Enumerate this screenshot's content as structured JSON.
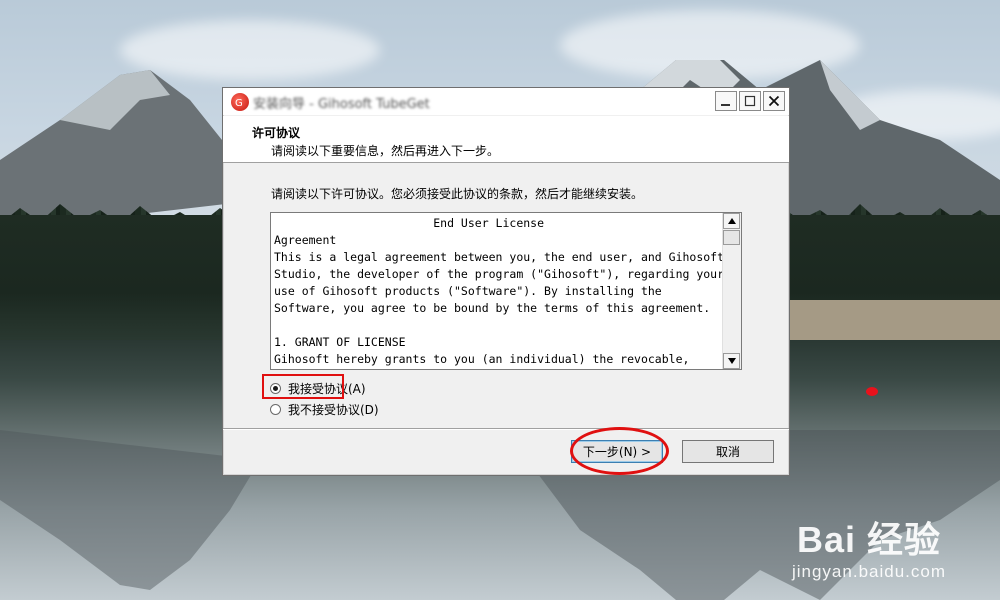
{
  "window": {
    "title": "安装向导 - Gihosoft TubeGet",
    "icon": "gihosoft-app-icon",
    "controls": [
      "minimize-icon",
      "maximize-icon",
      "close-icon"
    ]
  },
  "header": {
    "title": "许可协议",
    "subtitle": "请阅读以下重要信息，然后再进入下一步。"
  },
  "body": {
    "intro": "请阅读以下许可协议。您必须接受此协议的条款，然后才能继续安装。",
    "license_text": "                       End User License\nAgreement\nThis is a legal agreement between you, the end user, and Gihosoft\nStudio, the developer of the program (\"Gihosoft\"), regarding your\nuse of Gihosoft products (\"Software\"). By installing the\nSoftware, you agree to be bound by the terms of this agreement.\n\n1. GRANT OF LICENSE\nGihosoft hereby grants to you (an individual) the revocable,"
  },
  "options": {
    "accept_label": "我接受协议(A)",
    "decline_label": "我不接受协议(D)",
    "selected": "accept"
  },
  "buttons": {
    "next_label": "下一步(N) >",
    "cancel_label": "取消"
  },
  "watermark": {
    "logo_text": "Bai  经验",
    "url": "jingyan.baidu.com"
  },
  "colors": {
    "annotation_red": "#e01010",
    "dialog_bg": "#f0f0f0",
    "default_button_border": "#3c7fb1"
  }
}
